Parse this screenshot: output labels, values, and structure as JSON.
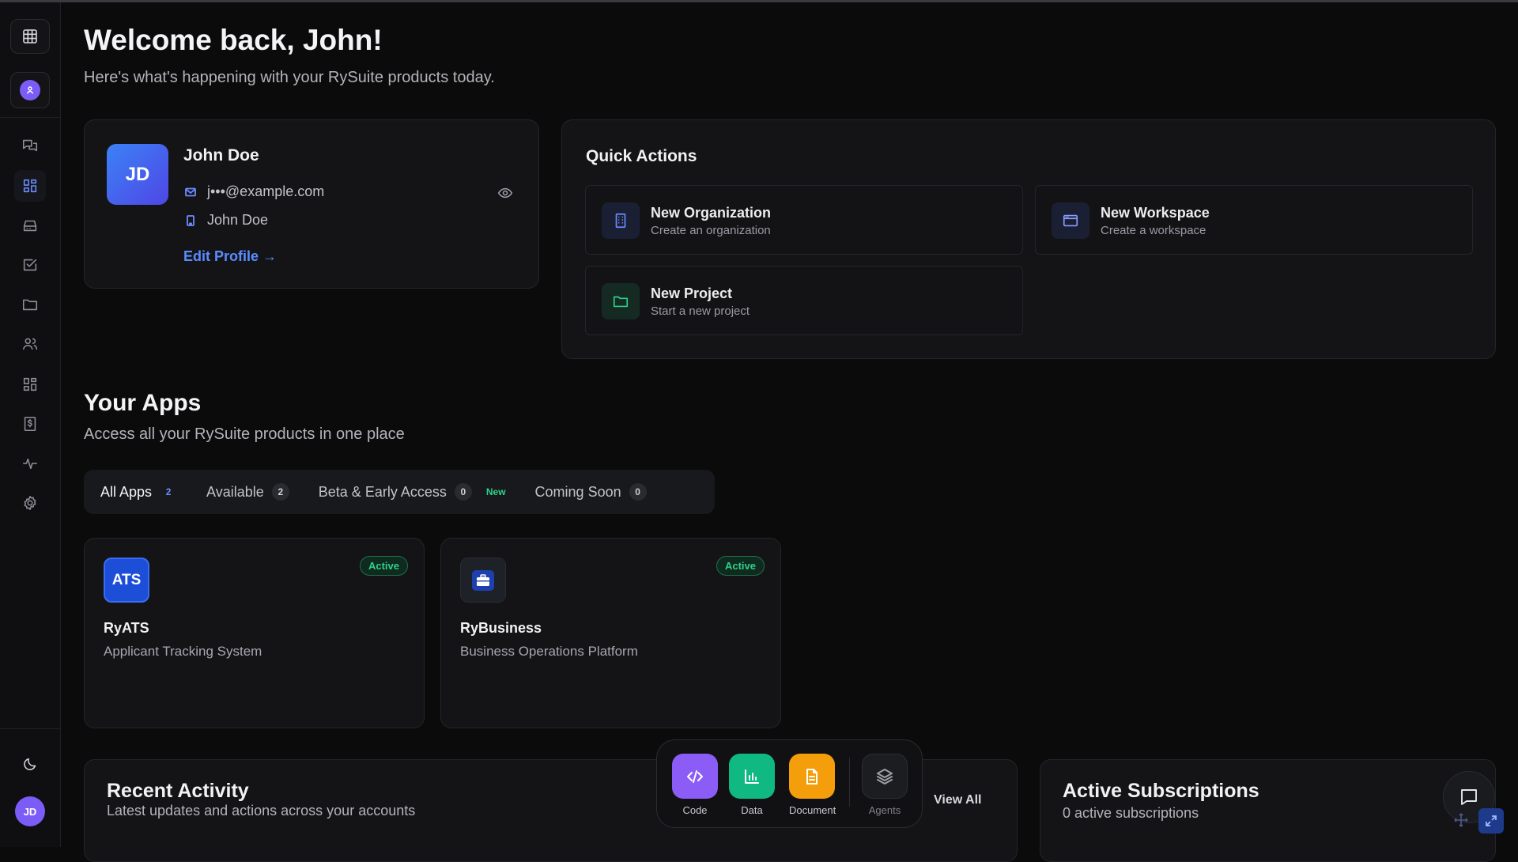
{
  "header": {
    "title": "Welcome back, John!",
    "subtitle": "Here's what's happening with your RySuite products today."
  },
  "sidebar": {
    "avatar_initials": "JD",
    "items": [
      {
        "icon": "chat-icon"
      },
      {
        "icon": "dashboard-icon",
        "active": true
      },
      {
        "icon": "inbox-icon"
      },
      {
        "icon": "tasks-icon"
      },
      {
        "icon": "folder-icon"
      },
      {
        "icon": "users-icon"
      },
      {
        "icon": "apps-icon"
      },
      {
        "icon": "billing-icon"
      },
      {
        "icon": "activity-icon"
      },
      {
        "icon": "gear-icon"
      }
    ],
    "theme_icon": "moon-icon"
  },
  "profile": {
    "initials": "JD",
    "name": "John Doe",
    "email": "j•••@example.com",
    "organization": "John Doe",
    "edit_label": "Edit Profile"
  },
  "quick_actions": {
    "title": "Quick Actions",
    "items": [
      {
        "title": "New Organization",
        "subtitle": "Create an organization",
        "icon": "building-icon"
      },
      {
        "title": "New Workspace",
        "subtitle": "Create a workspace",
        "icon": "workspace-icon"
      },
      {
        "title": "New Project",
        "subtitle": "Start a new project",
        "icon": "folder-icon"
      }
    ]
  },
  "apps_section": {
    "title": "Your Apps",
    "subtitle": "Access all your RySuite products in one place",
    "tabs": [
      {
        "label": "All Apps",
        "count": "2"
      },
      {
        "label": "Available",
        "count": "2"
      },
      {
        "label": "Beta & Early Access",
        "count": "0",
        "tag": "New"
      },
      {
        "label": "Coming Soon",
        "count": "0"
      }
    ],
    "apps": [
      {
        "icon_text": "ATS",
        "name": "RyATS",
        "description": "Applicant Tracking System",
        "status": "Active"
      },
      {
        "icon": "briefcase-icon",
        "name": "RyBusiness",
        "description": "Business Operations Platform",
        "status": "Active"
      }
    ]
  },
  "recent_activity": {
    "title": "Recent Activity",
    "subtitle": "Latest updates and actions across your accounts",
    "view_all": "View All"
  },
  "subscriptions": {
    "title": "Active Subscriptions",
    "subtitle": "0 active subscriptions"
  },
  "dock": {
    "items": [
      {
        "label": "Code",
        "color": "#8b5cf6"
      },
      {
        "label": "Data",
        "color": "#10b981"
      },
      {
        "label": "Document",
        "color": "#f59e0b"
      },
      {
        "label": "Agents",
        "color": "#1c1d21"
      }
    ]
  }
}
